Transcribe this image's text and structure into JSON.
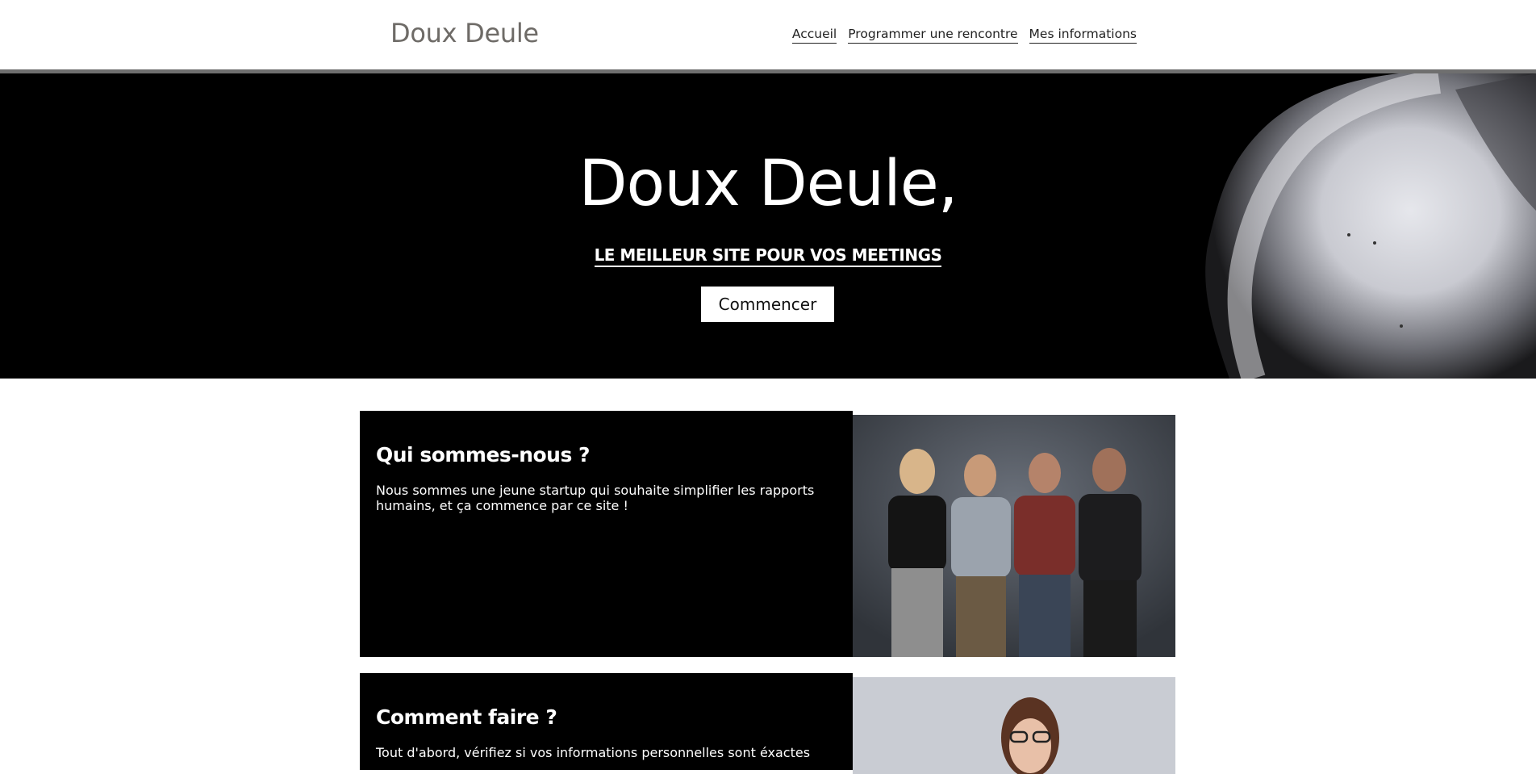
{
  "header": {
    "brand": "Doux Deule",
    "nav": [
      {
        "label": "Accueil"
      },
      {
        "label": "Programmer une rencontre"
      },
      {
        "label": "Mes informations"
      }
    ]
  },
  "hero": {
    "title": "Doux Deule,",
    "subtitle": "LE MEILLEUR SITE POUR VOS MEETINGS",
    "button_label": "Commencer"
  },
  "sections": [
    {
      "title": "Qui sommes-nous ?",
      "body": "Nous sommes une jeune startup qui souhaite simplifier les rapports humains, et ça commence par ce site !",
      "image": "group-photo"
    },
    {
      "title": "Comment faire ?",
      "body": "Tout d'abord, vérifiez si vos informations personnelles sont éxactes",
      "image": "woman-portrait"
    }
  ],
  "colors": {
    "accent": "#000000",
    "header_line": "#6f6f6f",
    "brand_text": "#6e6b67"
  }
}
